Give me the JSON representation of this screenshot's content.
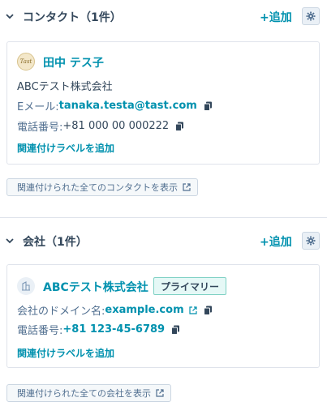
{
  "contacts_section": {
    "title": "コンタクト（1件）",
    "add_label": "+追加",
    "contact": {
      "avatar_text": "Tast",
      "name": "田中 テス子",
      "company": "ABCテスト株式会社",
      "email_label": "Eメール: ",
      "email": "tanaka.testa@tast.com",
      "phone_label": "電話番号: ",
      "phone": "+81 000 00 000222",
      "assoc_label": "関連付けラベルを追加"
    },
    "view_all": "関連付けられた全てのコンタクトを表示"
  },
  "companies_section": {
    "title": "会社（1件）",
    "add_label": "+追加",
    "company": {
      "name": "ABCテスト株式会社",
      "badge": "プライマリー",
      "domain_label": "会社のドメイン名: ",
      "domain": "example.com",
      "phone_label": "電話番号: ",
      "phone": "+81 123-45-6789",
      "assoc_label": "関連付けラベルを追加"
    },
    "view_all": "関連付けられた全ての会社を表示"
  },
  "colors": {
    "accent": "#0091ae",
    "text": "#33475b",
    "muted": "#516f90",
    "border": "#dfe3eb",
    "badge_border": "#7fd1c4"
  }
}
